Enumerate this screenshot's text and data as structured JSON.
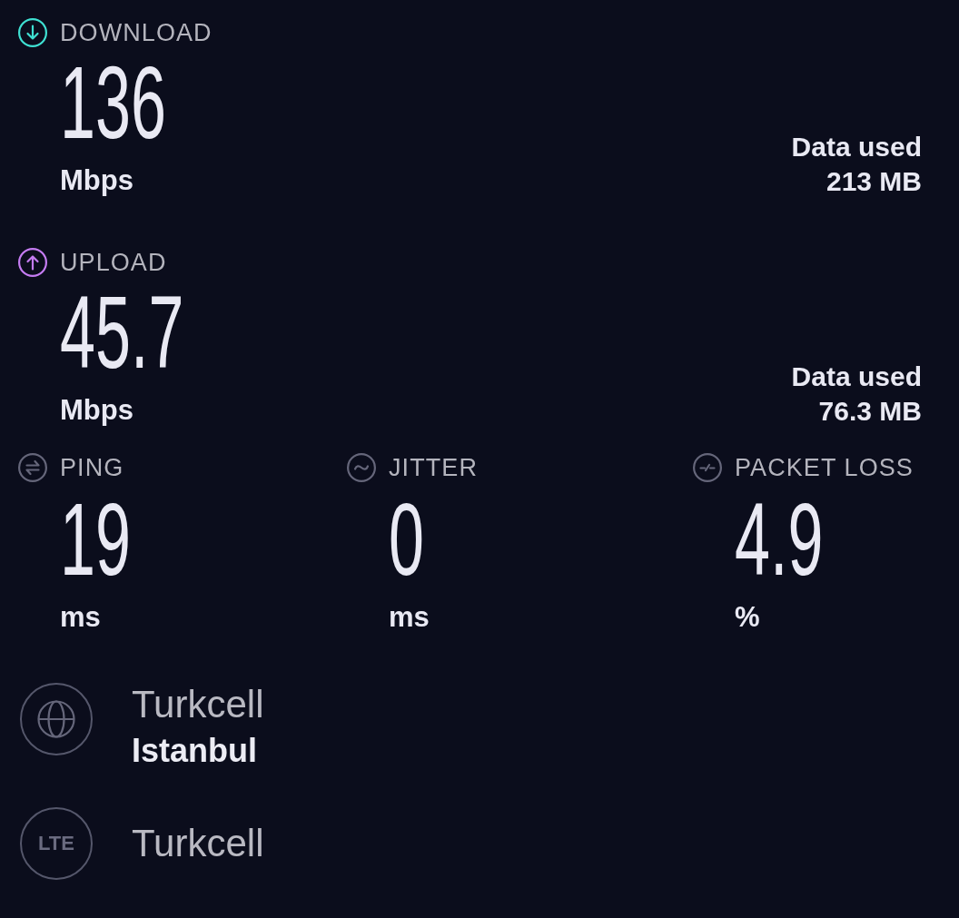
{
  "results": [
    {
      "kind": "download",
      "label": "DOWNLOAD",
      "value": "136",
      "unit": "Mbps",
      "data_used_label": "Data used",
      "data_used": "213 MB"
    },
    {
      "kind": "upload",
      "label": "UPLOAD",
      "value": "45.7",
      "unit": "Mbps",
      "data_used_label": "Data used",
      "data_used": "76.3 MB"
    }
  ],
  "metrics": [
    {
      "kind": "ping",
      "label": "PING",
      "value": "19",
      "unit": "ms"
    },
    {
      "kind": "jitter",
      "label": "JITTER",
      "value": "0",
      "unit": "ms"
    },
    {
      "kind": "packet_loss",
      "label": "PACKET LOSS",
      "value": "4.9",
      "unit": "%"
    }
  ],
  "connection": [
    {
      "kind": "server",
      "provider": "Turkcell",
      "location": "Istanbul"
    },
    {
      "kind": "network",
      "badge": "LTE",
      "provider": "Turkcell"
    }
  ]
}
